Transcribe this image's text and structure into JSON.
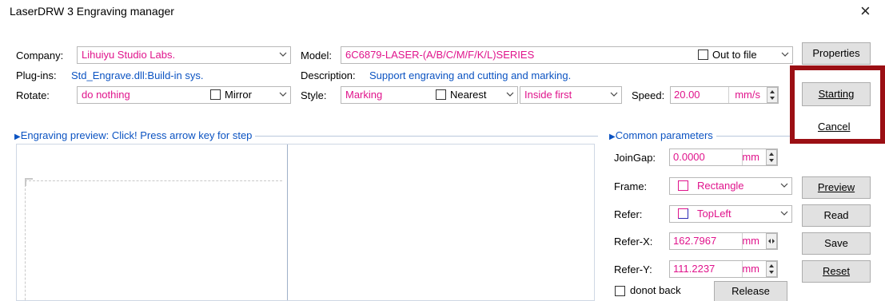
{
  "window": {
    "title": "LaserDRW 3 Engraving manager",
    "close_glyph": "×"
  },
  "company": {
    "label": "Company:",
    "value": "Lihuiyu Studio Labs."
  },
  "model": {
    "label": "Model:",
    "value": "6C6879-LASER-(A/B/C/M/F/K/L)SERIES",
    "out_to_file_label": "Out to file"
  },
  "plugins": {
    "label": "Plug-ins:",
    "value": "Std_Engrave.dll:Build-in sys."
  },
  "description": {
    "label": "Description:",
    "value": "Support engraving and cutting and marking."
  },
  "rotate": {
    "label": "Rotate:",
    "value": "do nothing",
    "mirror_label": "Mirror"
  },
  "style": {
    "label": "Style:",
    "value": "Marking",
    "nearest_label": "Nearest",
    "order_value": "Inside first"
  },
  "speed": {
    "label": "Speed:",
    "value": "20.00",
    "unit": "mm/s"
  },
  "buttons": {
    "properties": "Properties",
    "starting": "Starting",
    "cancel": "Cancel",
    "preview": "Preview",
    "read": "Read",
    "save": "Save",
    "reset": "Reset",
    "release": "Release"
  },
  "preview_panel": {
    "title": "Engraving preview: Click! Press arrow key for step"
  },
  "common": {
    "title": "Common parameters",
    "joingap": {
      "label": "JoinGap:",
      "value": "0.0000",
      "unit": "mm"
    },
    "frame": {
      "label": "Frame:",
      "value": "Rectangle"
    },
    "refer": {
      "label": "Refer:",
      "value": "TopLeft"
    },
    "refer_x": {
      "label": "Refer-X:",
      "value": "162.7967",
      "unit": "mm"
    },
    "refer_y": {
      "label": "Refer-Y:",
      "value": "111.2237",
      "unit": "mm"
    },
    "donot_back_label": "donot back"
  },
  "colors": {
    "accent_text": "#e0148c",
    "link_blue": "#0b53c2",
    "highlight_box": "#9b0f14"
  }
}
